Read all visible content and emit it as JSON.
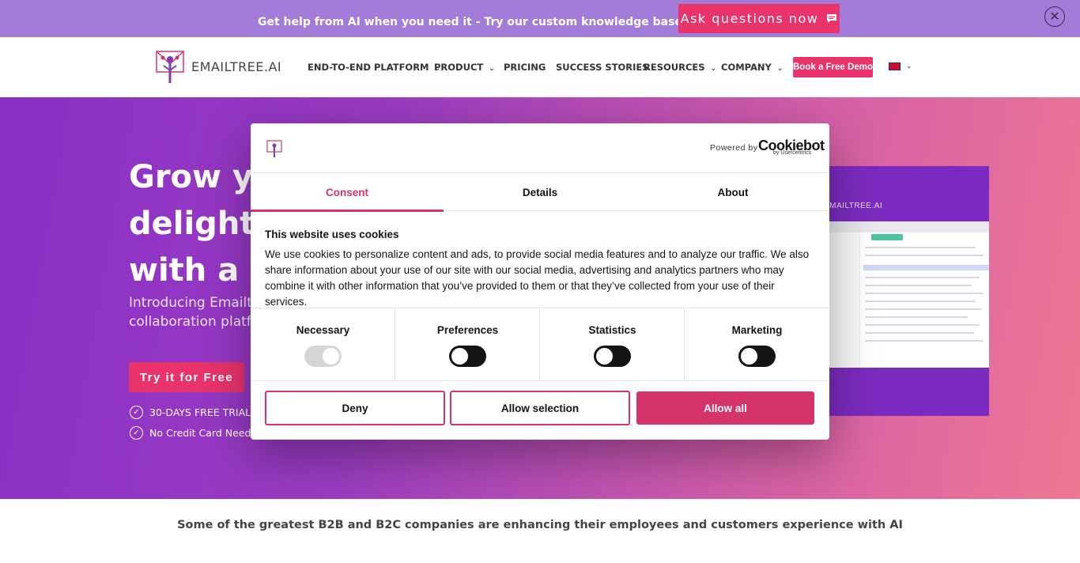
{
  "topbar": {
    "message": "Get help from AI when you need it - Try our custom knowledge base for free today!",
    "cta_label": "Ask questions now",
    "cta_icon": "chat-bubble-icon",
    "close_icon": "close-icon"
  },
  "nav": {
    "brand": "EMAILTREE.AI",
    "items": [
      {
        "label": "END-TO-END PLATFORM",
        "has_menu": true
      },
      {
        "label": "PRODUCT",
        "has_menu": true
      },
      {
        "label": "PRICING",
        "has_menu": false
      },
      {
        "label": "SUCCESS STORIES",
        "has_menu": false
      },
      {
        "label": "RESOURCES",
        "has_menu": true
      },
      {
        "label": "COMPANY",
        "has_menu": true
      }
    ],
    "demo_label": "Book a Free Demo",
    "language_icon": "uk-flag-icon"
  },
  "hero": {
    "title_lines": [
      "Grow you",
      "delight y",
      "with a Hu"
    ],
    "subtitle_lines": [
      "Introducing Emailtr",
      "collaboration platfo"
    ],
    "cta_label": "Try it for Free",
    "checks": [
      "30-DAYS FREE TRIAL",
      "No Credit Card Needed"
    ],
    "product_logo": "EMAILTREE.AI"
  },
  "tagline": "Some of the greatest B2B and B2C companies are enhancing their employees and customers experience with AI",
  "cookie": {
    "powered_by": "Powered by",
    "brand": "Cookiebot",
    "brand_sub": "by Usercentrics",
    "tabs": [
      "Consent",
      "Details",
      "About"
    ],
    "active_tab": "Consent",
    "title": "This website uses cookies",
    "body": "We use cookies to personalize content and ads, to provide social media features and to analyze our traffic. We also share information about your use of our site with our social media, advertising and analytics partners who may combine it with other information that you’ve provided to them or that they’ve collected from your use of their services.",
    "categories": [
      {
        "label": "Necessary",
        "state": "on",
        "disabled": true
      },
      {
        "label": "Preferences",
        "state": "off",
        "disabled": false
      },
      {
        "label": "Statistics",
        "state": "off",
        "disabled": false
      },
      {
        "label": "Marketing",
        "state": "off",
        "disabled": false
      }
    ],
    "buttons": {
      "deny": "Deny",
      "allow_selection": "Allow selection",
      "allow_all": "Allow all"
    }
  },
  "colors": {
    "accent": "#e8336b",
    "cookie_accent": "#d6336c",
    "topbar": "#a37bd8"
  }
}
